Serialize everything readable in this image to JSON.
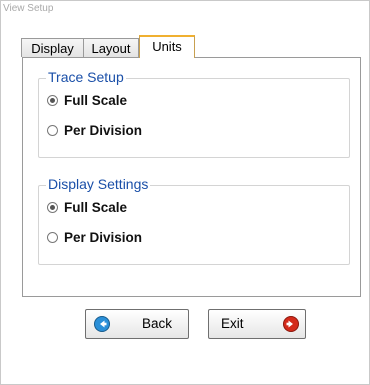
{
  "window": {
    "title": "View Setup"
  },
  "tabs": [
    {
      "label": "Display",
      "active": false
    },
    {
      "label": "Layout",
      "active": false
    },
    {
      "label": "Units",
      "active": true
    }
  ],
  "trace_setup": {
    "legend": "Trace Setup",
    "options": [
      {
        "label": "Full Scale",
        "selected": true
      },
      {
        "label": "Per Division",
        "selected": false
      }
    ]
  },
  "display_settings": {
    "legend": "Display Settings",
    "options": [
      {
        "label": "Full Scale",
        "selected": true
      },
      {
        "label": "Per Division",
        "selected": false
      }
    ]
  },
  "buttons": {
    "back_label": "Back",
    "exit_label": "Exit"
  },
  "colors": {
    "legend_text": "#1a4fa8",
    "active_tab_accent": "#f0b030",
    "back_icon": "#2a8fd8",
    "exit_icon": "#d42a1a"
  },
  "icons": {
    "back": "arrow-left-circle-icon",
    "exit": "arrow-right-circle-icon"
  }
}
